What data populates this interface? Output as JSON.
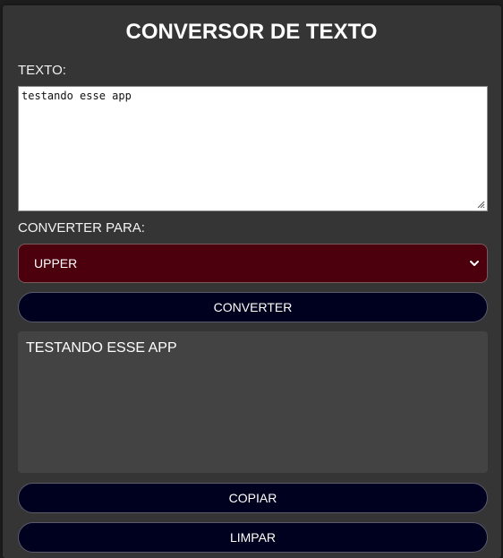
{
  "app": {
    "title": "CONVERSOR DE TEXTO"
  },
  "input": {
    "label": "TEXTO:",
    "value": "testando esse app"
  },
  "convert_to": {
    "label": "CONVERTER PARA:",
    "selected": "UPPER"
  },
  "buttons": {
    "convert": "CONVERTER",
    "copy": "COPIAR",
    "clear": "LIMPAR"
  },
  "output": {
    "value": "TESTANDO ESSE APP"
  },
  "colors": {
    "panel_bg": "#353535",
    "select_bg": "#4c000d",
    "button_bg": "#00001f",
    "output_bg": "#434343"
  },
  "icons": {
    "select_arrow": "chevron-down-icon",
    "textarea_resize": "resize-handle-icon"
  }
}
